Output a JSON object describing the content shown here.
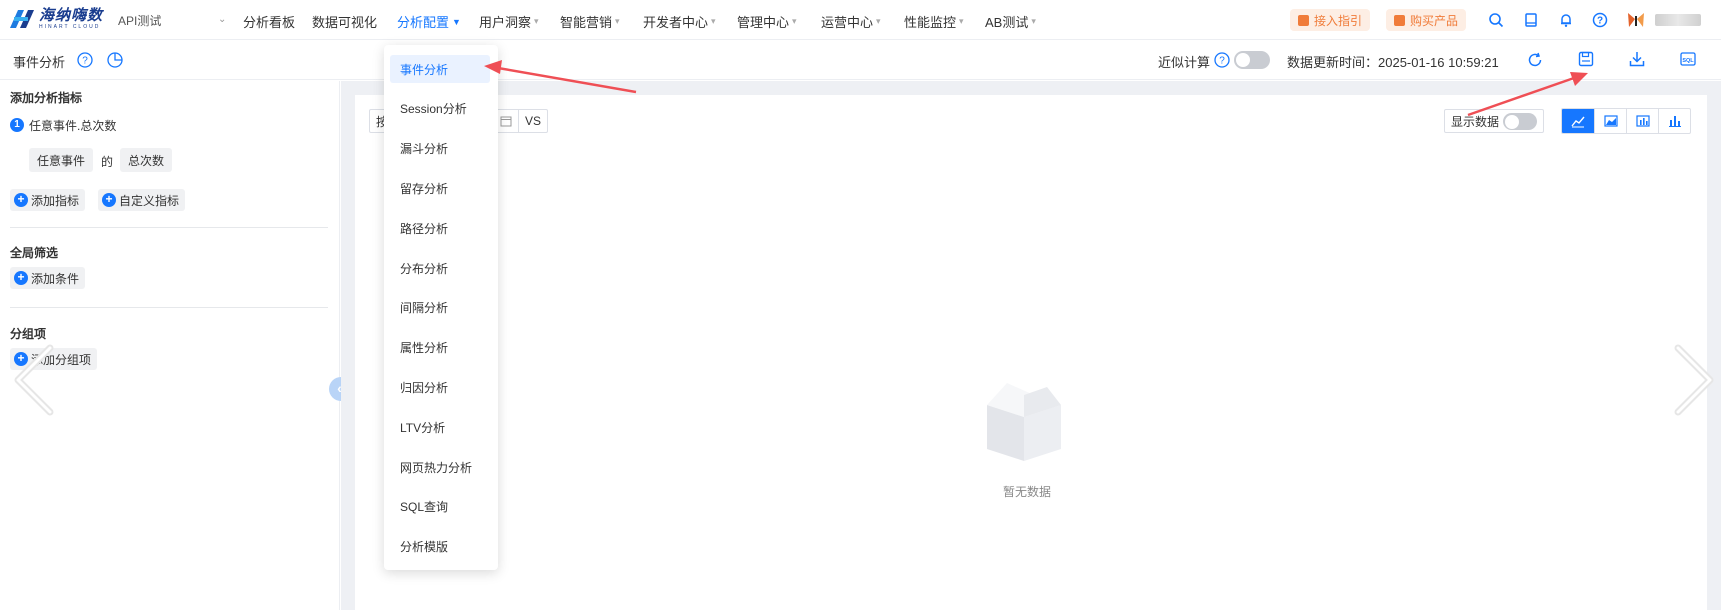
{
  "header": {
    "logo_cn": "海纳嗨数",
    "logo_en": "HINART CLOUD",
    "project": "API测试",
    "nav": [
      {
        "label": "分析看板",
        "caret": false,
        "active": false
      },
      {
        "label": "数据可视化",
        "caret": false,
        "active": false
      },
      {
        "label": "分析配置",
        "caret": true,
        "active": true
      },
      {
        "label": "用户洞察",
        "caret": true,
        "active": false
      },
      {
        "label": "智能营销",
        "caret": true,
        "active": false
      },
      {
        "label": "开发者中心",
        "caret": true,
        "active": false
      },
      {
        "label": "管理中心",
        "caret": true,
        "active": false
      },
      {
        "label": "运营中心",
        "caret": true,
        "active": false
      },
      {
        "label": "性能监控",
        "caret": true,
        "active": false
      },
      {
        "label": "AB测试",
        "caret": true,
        "active": false
      }
    ],
    "access_guide": "接入指引",
    "buy_product": "购买产品",
    "accent_color": "#1677ff",
    "pill_color": "#f07c3a"
  },
  "subbar": {
    "title": "事件分析",
    "approx_label": "近似计算",
    "update_label": "数据更新时间：2025-01-16 10:59:21"
  },
  "left": {
    "metrics_title": "添加分析指标",
    "metric_index": "1",
    "metric_name": "任意事件.总次数",
    "event_chip": "任意事件",
    "of_text": "的",
    "agg_chip": "总次数",
    "add_metric": "添加指标",
    "custom_metric": "自定义指标",
    "filter_title": "全局筛选",
    "add_condition": "添加条件",
    "group_title": "分组项",
    "add_group": "添加分组项"
  },
  "main": {
    "vs_prefix": "按",
    "vs_label": "VS",
    "show_data": "显示数据",
    "empty_text": "暂无数据"
  },
  "dropdown": {
    "items": [
      "事件分析",
      "Session分析",
      "漏斗分析",
      "留存分析",
      "路径分析",
      "分布分析",
      "间隔分析",
      "属性分析",
      "归因分析",
      "LTV分析",
      "网页热力分析",
      "SQL查询",
      "分析模版"
    ],
    "active_index": 0
  }
}
